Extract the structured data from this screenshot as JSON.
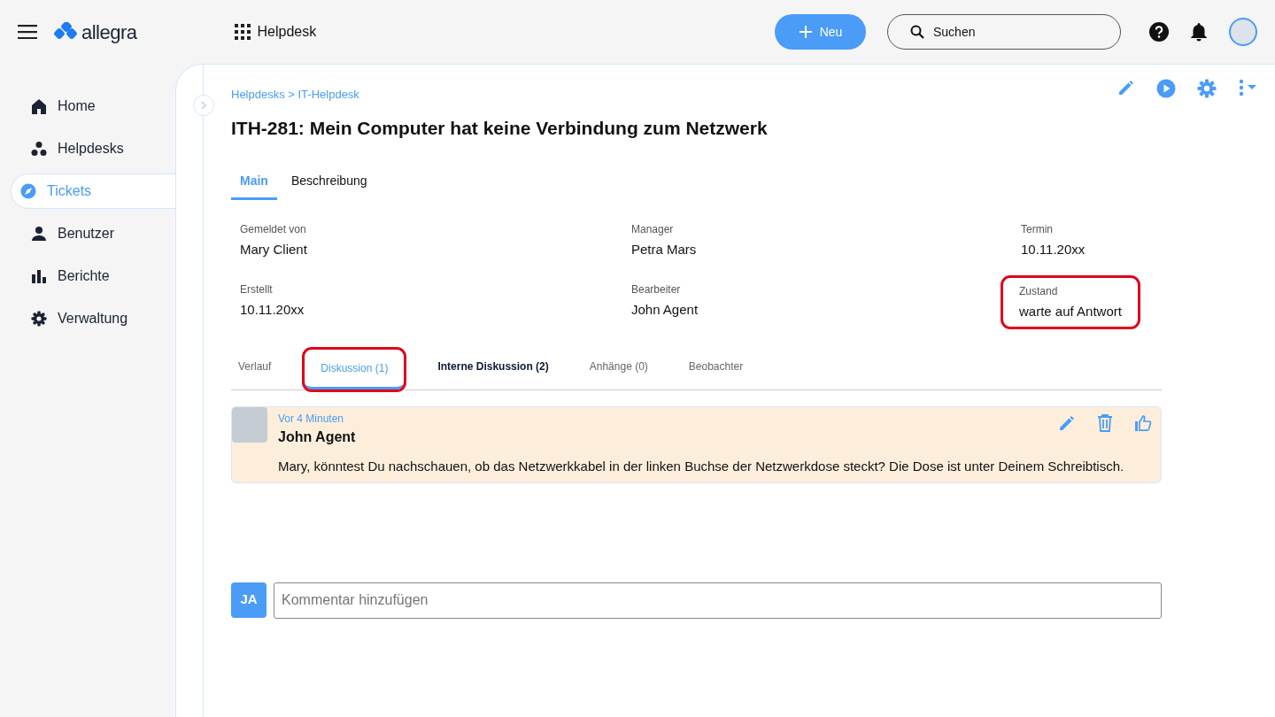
{
  "topbar": {
    "brand": "allegra",
    "app": "Helpdesk",
    "new_button": "Neu",
    "search": {
      "placeholder": "Suchen"
    }
  },
  "sidebar": {
    "items": [
      {
        "label": "Home",
        "selected": false
      },
      {
        "label": "Helpdesks",
        "selected": false
      },
      {
        "label": "Tickets",
        "selected": true
      },
      {
        "label": "Benutzer",
        "selected": false
      },
      {
        "label": "Berichte",
        "selected": false
      },
      {
        "label": "Verwaltung",
        "selected": false
      }
    ]
  },
  "breadcrumb": "Helpdesks > IT-Helpdesk",
  "title": "ITH-281: Mein Computer hat keine Verbindung zum Netzwerk",
  "main_tabs": [
    {
      "label": "Main",
      "selected": true
    },
    {
      "label": "Beschreibung",
      "selected": false
    }
  ],
  "fields": [
    {
      "label": "Gemeldet von",
      "value": "Mary Client",
      "highlighted": false
    },
    {
      "label": "Manager",
      "value": "Petra Mars",
      "highlighted": false
    },
    {
      "label": "Termin",
      "value": "10.11.20xx",
      "highlighted": false
    },
    {
      "label": "Erstellt",
      "value": "10.11.20xx",
      "highlighted": false
    },
    {
      "label": "Bearbeiter",
      "value": "John Agent",
      "highlighted": false
    },
    {
      "label": "Zustand",
      "value": "warte auf Antwort",
      "highlighted": true
    }
  ],
  "sub_tabs": [
    {
      "label": "Verlauf",
      "selected": false,
      "emphasized": false,
      "highlighted": false
    },
    {
      "label": "Diskussion (1)",
      "selected": true,
      "emphasized": false,
      "highlighted": true
    },
    {
      "label": "Interne Diskussion (2)",
      "selected": false,
      "emphasized": true,
      "highlighted": false
    },
    {
      "label": "Anhänge (0)",
      "selected": false,
      "emphasized": false,
      "highlighted": false
    },
    {
      "label": "Beobachter",
      "selected": false,
      "emphasized": false,
      "highlighted": false
    }
  ],
  "comments": [
    {
      "time": "Vor 4 Minuten",
      "author": "John Agent",
      "text": "Mary, könntest Du nachschauen, ob das Netzwerkkabel in der linken Buchse der Netzwerkdose steckt? Die Dose ist unter Deinem Schreibtisch."
    }
  ],
  "comment_input": {
    "initials": "JA",
    "placeholder": "Kommentar hinzufügen"
  }
}
